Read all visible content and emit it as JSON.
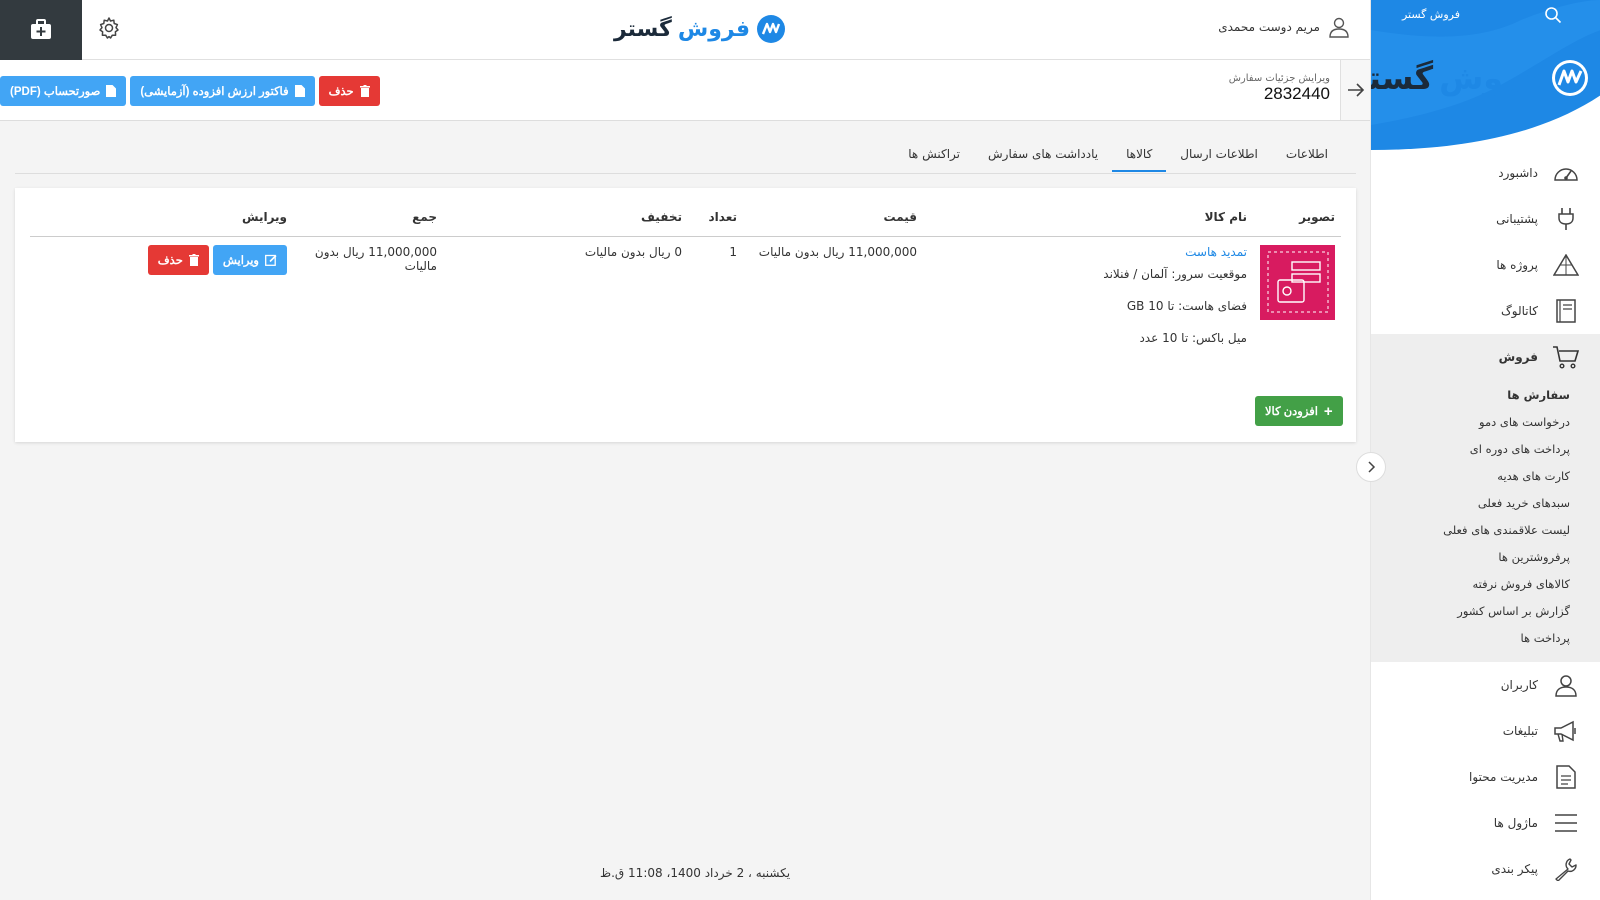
{
  "sidebar": {
    "brand_small": "فروش گستر",
    "logo_word1": "فروش",
    "logo_word2": "گستر",
    "items": [
      {
        "label": "داشبورد",
        "icon": "dashboard-icon"
      },
      {
        "label": "پشتیبانی",
        "icon": "plug-icon"
      },
      {
        "label": "پروژه ها",
        "icon": "project-icon"
      },
      {
        "label": "کاتالوگ",
        "icon": "catalog-icon"
      },
      {
        "label": "فروش",
        "icon": "cart-icon"
      },
      {
        "label": "کاربران",
        "icon": "user-icon"
      },
      {
        "label": "تبلیغات",
        "icon": "megaphone-icon"
      },
      {
        "label": "مدیریت محتوا",
        "icon": "document-icon"
      },
      {
        "label": "ماژول ها",
        "icon": "menu-icon"
      },
      {
        "label": "پیکر بندی",
        "icon": "wrench-icon"
      }
    ],
    "submenu": [
      "سفارش ها",
      "درخواست های دمو",
      "پرداخت های دوره ای",
      "کارت های هدیه",
      "سبدهای خرید فعلی",
      "لیست علاقمندی های فعلی",
      "پرفروشترین ها",
      "کالاهای فروش نرفته",
      "گزارش بر اساس کشور",
      "پرداخت ها"
    ]
  },
  "topbar": {
    "user_name": "مریم دوست محمدی",
    "logo_word1": "فروش",
    "logo_word2": "گستر"
  },
  "order": {
    "heading": "ویرایش جزئیات سفارش",
    "number": "2832440"
  },
  "actions": {
    "invoice_pdf": "صورتحساب (PDF)",
    "vat_invoice": "فاکتور ارزش افزوده (آزمایشی)",
    "delete": "حذف"
  },
  "tabs": [
    "اطلاعات",
    "اطلاعات ارسال",
    "کالاها",
    "یادداشت های سفارش",
    "تراکنش ها"
  ],
  "table": {
    "headers": {
      "image": "تصویر",
      "name": "نام کالا",
      "price": "قیمت",
      "qty": "تعداد",
      "discount": "تخفیف",
      "total": "جمع",
      "edit": "ویرایش"
    },
    "row": {
      "name": "تمدید هاست",
      "attr1": "موقعیت سرور: آلمان / فنلاند",
      "attr2": "فضای هاست: تا 10 GB",
      "attr3": "میل باکس: تا 10 عدد",
      "price": "11,000,000 ریال بدون مالیات",
      "qty": "1",
      "discount": "0 ریال بدون مالیات",
      "total": "11,000,000 ریال بدون مالیات",
      "edit_label": "ویرایش",
      "delete_label": "حذف"
    },
    "add_label": "افزودن کالا"
  },
  "footer": {
    "datetime": "یکشنبه ، 2 خرداد 1400، 11:08 ق.ظ"
  },
  "colors": {
    "accent": "#1e88e5",
    "blue_button": "#42a5f5",
    "red_button": "#e53935",
    "green_button": "#43a047",
    "dark": "#333a3f"
  }
}
